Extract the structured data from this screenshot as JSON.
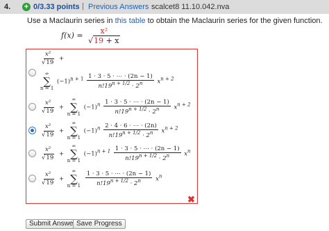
{
  "header": {
    "question_number": "4.",
    "points": "0/3.33 points",
    "separator": "|",
    "previous_answers": "Previous Answers",
    "source": "scalcet8 11.10.042.nva",
    "plus_icon": "+"
  },
  "instructions": {
    "before": "Use a Maclaurin series in ",
    "link": "this table",
    "after": " to obtain the Maclaurin series for the given function."
  },
  "function": {
    "lhs": "f(x) =",
    "numerator": "x²",
    "sqrt_const": "19",
    "sqrt_rest": "+ x"
  },
  "options": [
    {
      "id": "A",
      "selected": false,
      "lead_num": "x²",
      "lead_den": "19",
      "plus": "+",
      "sum_upper": "∞",
      "sum_lower": "n = 1",
      "sign": "(−1)",
      "sign_exp": "n + 1",
      "num": "1 · 3 · 5 · ⋯ · (2n − 1)",
      "den": "n!19",
      "den_exp": "n + 1/2",
      "den_tail": " · 2",
      "den_tail_exp": "n",
      "tail": "x",
      "tail_exp": "n + 2"
    },
    {
      "id": "B",
      "selected": false,
      "lead_num": "x²",
      "lead_den": "19",
      "plus": "+",
      "sum_upper": "∞",
      "sum_lower": "n = 1",
      "sign": "(−1)",
      "sign_exp": "n",
      "num": "1 · 3 · 5 · ⋯ · (2n − 1)",
      "den": "n!19",
      "den_exp": "n + 1/2",
      "den_tail": " · 2",
      "den_tail_exp": "n",
      "tail": "x",
      "tail_exp": "n + 2"
    },
    {
      "id": "C",
      "selected": true,
      "lead_num": "x²",
      "lead_den": "19",
      "plus": "+",
      "sum_upper": "∞",
      "sum_lower": "n = 1",
      "sign": "(−1)",
      "sign_exp": "n",
      "num": "2 · 4 · 6 · ⋯ · (2n)",
      "den": "n!19",
      "den_exp": "n + 1/2",
      "den_tail": " · 2",
      "den_tail_exp": "n",
      "tail": "x",
      "tail_exp": "n + 2"
    },
    {
      "id": "D",
      "selected": false,
      "lead_num": "x²",
      "lead_den": "19",
      "plus": "+",
      "sum_upper": "∞",
      "sum_lower": "n = 1",
      "sign": "(−1)",
      "sign_exp": "n + 1",
      "num": "1 · 3 · 5 · ⋯ · (2n − 1)",
      "den": "n!19",
      "den_exp": "n + 1/2",
      "den_tail": " · 2",
      "den_tail_exp": "n",
      "tail": "x",
      "tail_exp": "n"
    },
    {
      "id": "E",
      "selected": false,
      "lead_num": "x²",
      "lead_den": "19",
      "plus": "+",
      "sum_upper": "∞",
      "sum_lower": "n = 1",
      "sign": "",
      "sign_exp": "",
      "num": "1 · 3 · 5 · ⋯ · (2n − 1)",
      "den": "n!19",
      "den_exp": "n + 1/2",
      "den_tail": " · 2",
      "den_tail_exp": "n",
      "tail": "x",
      "tail_exp": "n"
    }
  ],
  "feedback_mark": "✖",
  "buttons": {
    "submit": "Submit Answer",
    "save": "Save Progress"
  },
  "colors": {
    "header_bg": "#dcdcdc",
    "points": "#1a4f9c",
    "link": "#2361b8",
    "incorrect": "#d33333",
    "correct_icon": "#2f9e3a"
  }
}
